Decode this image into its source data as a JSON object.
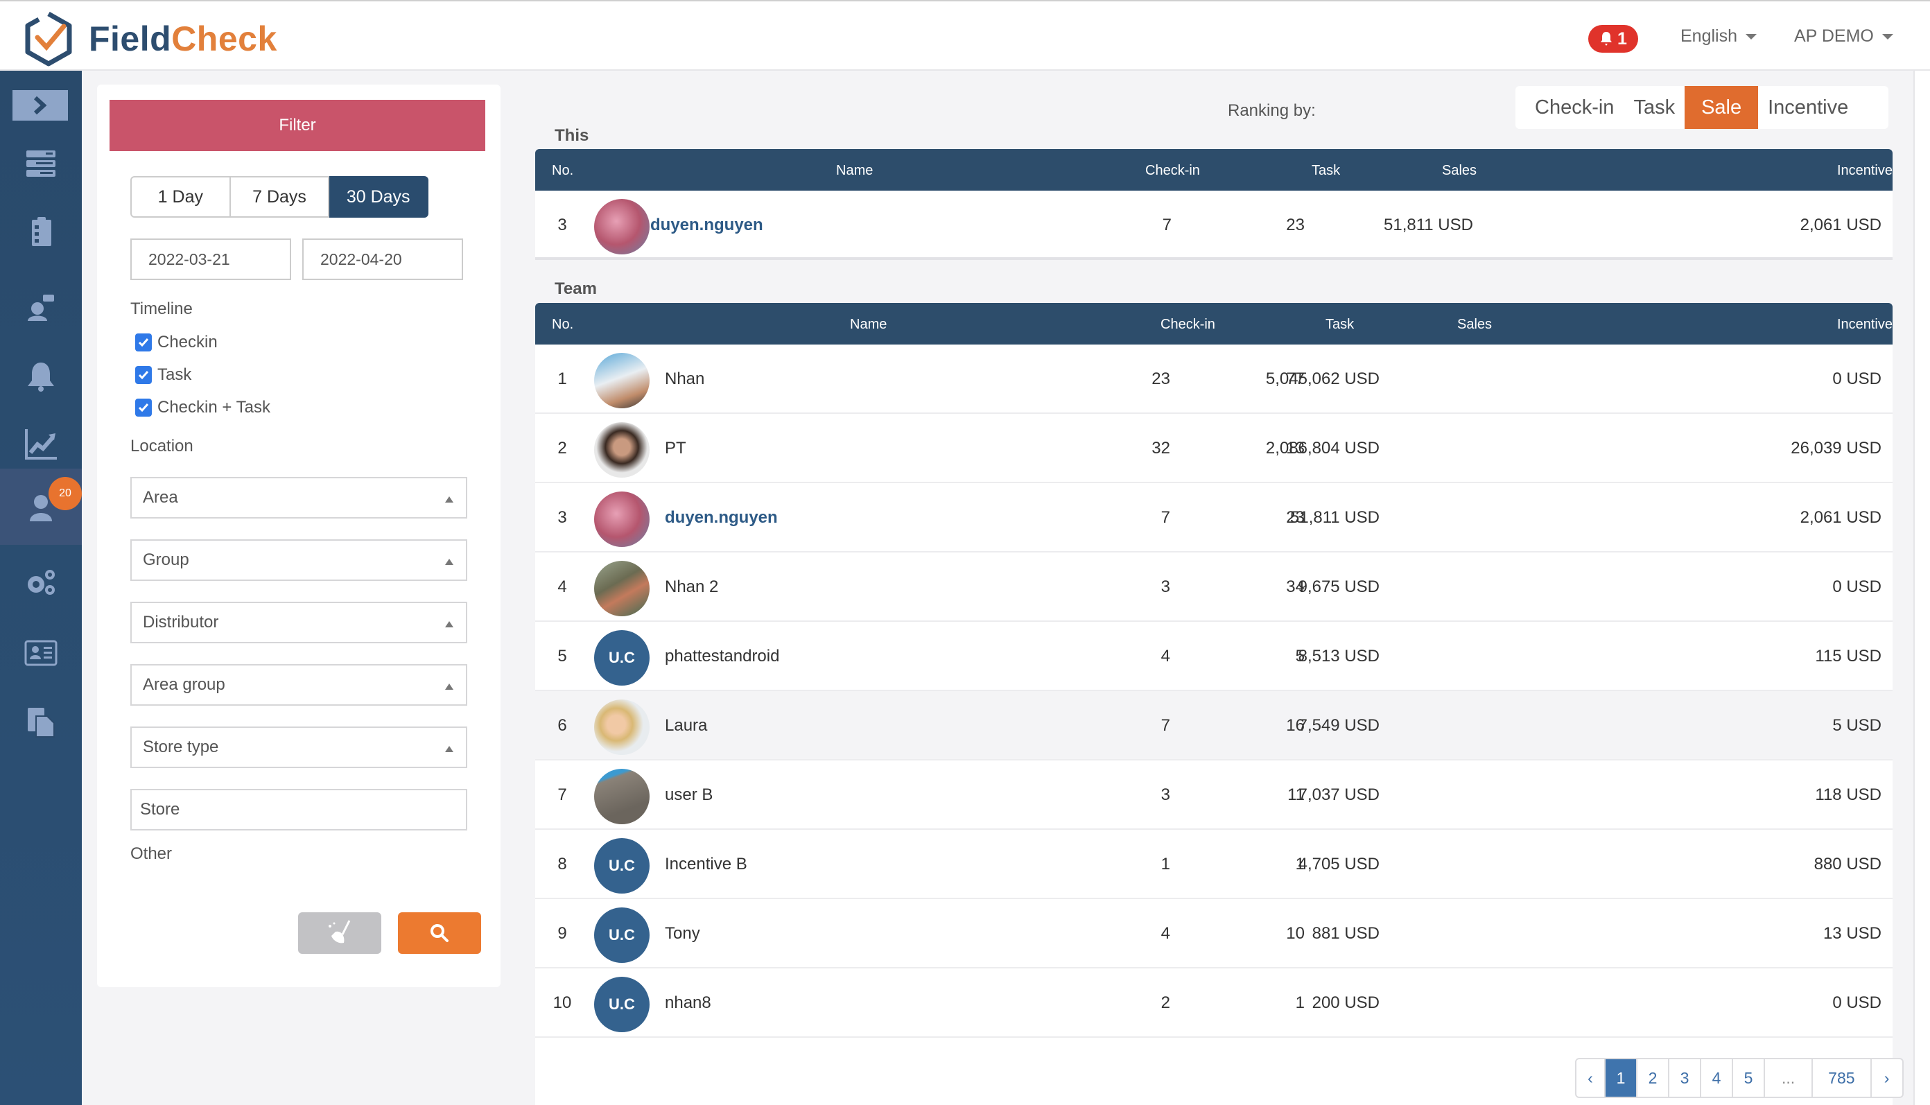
{
  "header": {
    "brand_part1": "Field",
    "brand_part2": "Check",
    "notification_count": "1",
    "language": "English",
    "account": "AP DEMO"
  },
  "sidebar": {
    "items": [
      {
        "icon": "list-icon"
      },
      {
        "icon": "clipboard-checklist-icon"
      },
      {
        "icon": "chat-user-icon"
      },
      {
        "icon": "bell-icon"
      },
      {
        "icon": "chart-line-icon"
      },
      {
        "icon": "user-icon",
        "badge": "20",
        "active": true
      },
      {
        "icon": "gears-icon"
      },
      {
        "icon": "id-card-icon"
      },
      {
        "icon": "documents-icon"
      }
    ]
  },
  "filter": {
    "title": "Filter",
    "ranges": [
      "1 Day",
      "7 Days",
      "30 Days"
    ],
    "active_range": "30 Days",
    "date_from": "2022-03-21",
    "date_to": "2022-04-20",
    "timeline_label": "Timeline",
    "timeline_options": [
      {
        "label": "Checkin",
        "checked": true
      },
      {
        "label": "Task",
        "checked": true
      },
      {
        "label": "Checkin + Task",
        "checked": true
      }
    ],
    "location_label": "Location",
    "selects": [
      "Area",
      "Group",
      "Distributor",
      "Area group",
      "Store type"
    ],
    "store_placeholder": "Store",
    "other_label": "Other"
  },
  "ranking": {
    "label": "Ranking by:",
    "tabs": [
      "Check-in",
      "Task",
      "Sale",
      "Incentive"
    ],
    "active": "Sale"
  },
  "columns": {
    "no": "No.",
    "name": "Name",
    "checkin": "Check-in",
    "task": "Task",
    "sales": "Sales",
    "incentive": "Incentive"
  },
  "this_section": {
    "title": "This",
    "row": {
      "no": "3",
      "name": "duyen.nguyen",
      "checkin": "7",
      "task": "23",
      "sales": "51,811 USD",
      "incentive": "2,061 USD",
      "avatar": "photo"
    }
  },
  "team_section": {
    "title": "Team",
    "rows": [
      {
        "no": "1",
        "name": "Nhan",
        "checkin": "23",
        "task": "77",
        "sales": "5,045,062 USD",
        "incentive": "0 USD",
        "avatar": "photo"
      },
      {
        "no": "2",
        "name": "PT",
        "checkin": "32",
        "task": "13",
        "sales": "2,086,804 USD",
        "incentive": "26,039 USD",
        "avatar": "photo"
      },
      {
        "no": "3",
        "name": "duyen.nguyen",
        "checkin": "7",
        "task": "23",
        "sales": "51,811 USD",
        "incentive": "2,061 USD",
        "avatar": "photo",
        "current_user": true
      },
      {
        "no": "4",
        "name": "Nhan 2",
        "checkin": "3",
        "task": "34",
        "sales": "9,675 USD",
        "incentive": "0 USD",
        "avatar": "photo"
      },
      {
        "no": "5",
        "name": "phattestandroid",
        "checkin": "4",
        "task": "5",
        "sales": "8,513 USD",
        "incentive": "115 USD",
        "avatar": "U.C"
      },
      {
        "no": "6",
        "name": "Laura",
        "checkin": "7",
        "task": "16",
        "sales": "7,549 USD",
        "incentive": "5 USD",
        "avatar": "photo",
        "highlighted": true
      },
      {
        "no": "7",
        "name": "user B",
        "checkin": "3",
        "task": "11",
        "sales": "7,037 USD",
        "incentive": "118 USD",
        "avatar": "photo"
      },
      {
        "no": "8",
        "name": "Incentive B",
        "checkin": "1",
        "task": "1",
        "sales": "4,705 USD",
        "incentive": "880 USD",
        "avatar": "U.C"
      },
      {
        "no": "9",
        "name": "Tony",
        "checkin": "4",
        "task": "10",
        "sales": "881 USD",
        "incentive": "13 USD",
        "avatar": "U.C"
      },
      {
        "no": "10",
        "name": "nhan8",
        "checkin": "2",
        "task": "1",
        "sales": "200 USD",
        "incentive": "0 USD",
        "avatar": "U.C"
      }
    ]
  },
  "pagination": {
    "prev": "‹",
    "pages": [
      "1",
      "2",
      "3",
      "4",
      "5",
      "...",
      "785"
    ],
    "current": "1",
    "next": "›"
  },
  "colors": {
    "brand_blue": "#2d4d6f",
    "brand_orange": "#e2803b",
    "filter_header": "#c9546a",
    "active_tab": "#e06c2e",
    "table_header": "#2d4d6b",
    "avatar_placeholder": "#34628e"
  }
}
